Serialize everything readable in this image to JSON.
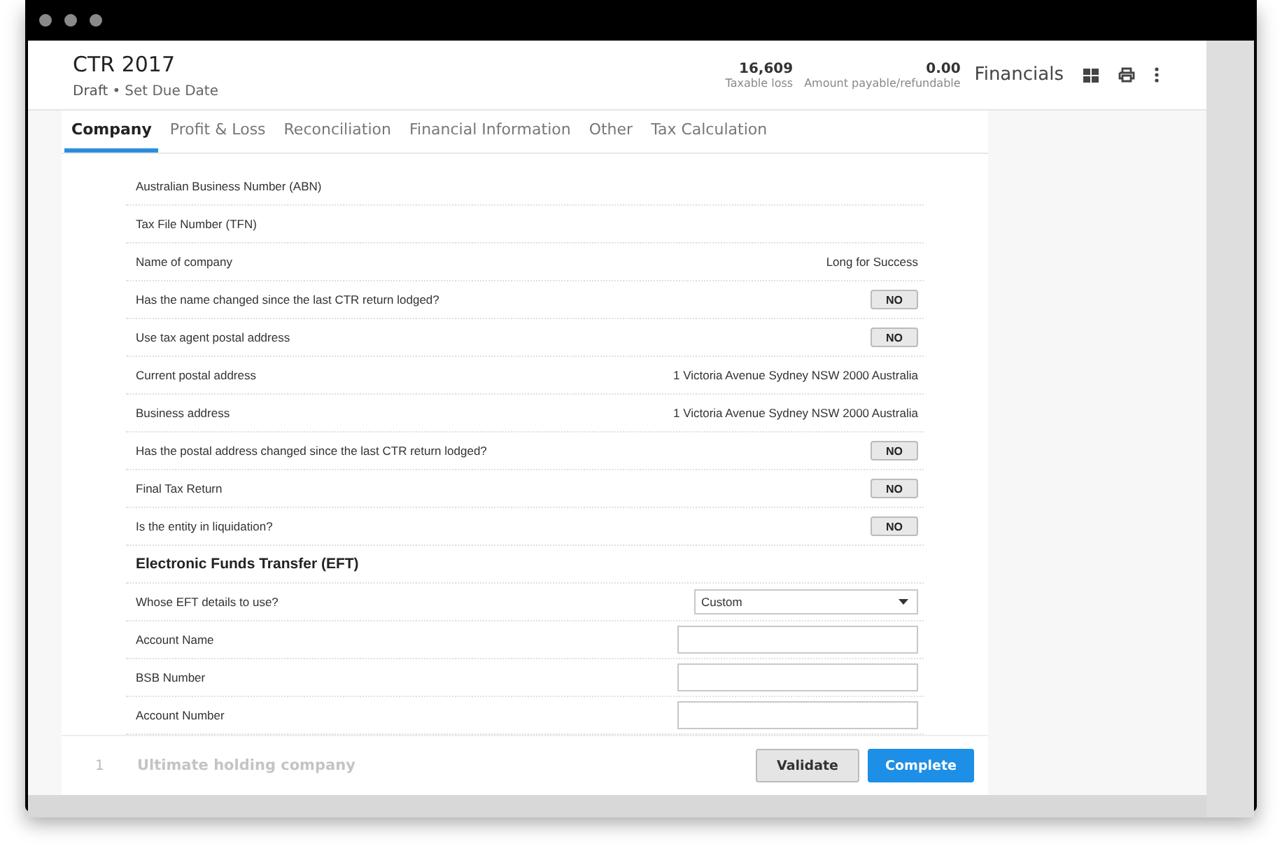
{
  "header": {
    "title": "CTR 2017",
    "status": "Draft",
    "separator": "•",
    "due_date_link": "Set Due Date",
    "stats": [
      {
        "value": "16,609",
        "label": "Taxable loss"
      },
      {
        "value": "0.00",
        "label": "Amount payable/refundable"
      }
    ],
    "financials_link": "Financials"
  },
  "tabs": [
    {
      "label": "Company",
      "selected": true
    },
    {
      "label": "Profit & Loss",
      "selected": false
    },
    {
      "label": "Reconciliation",
      "selected": false
    },
    {
      "label": "Financial Information",
      "selected": false
    },
    {
      "label": "Other",
      "selected": false
    },
    {
      "label": "Tax Calculation",
      "selected": false
    }
  ],
  "rows": [
    {
      "kind": "text",
      "label": "Australian Business Number (ABN)"
    },
    {
      "kind": "text",
      "label": "Tax File Number (TFN)"
    },
    {
      "kind": "text",
      "label": "Name of company",
      "value": "Long for Success"
    },
    {
      "kind": "toggle",
      "label": "Has the name changed since the last CTR return lodged?",
      "value": "NO"
    },
    {
      "kind": "toggle",
      "label": "Use tax agent postal address",
      "value": "NO"
    },
    {
      "kind": "text",
      "label": "Current postal address",
      "value": "1 Victoria Avenue Sydney NSW 2000 Australia"
    },
    {
      "kind": "text",
      "label": "Business address",
      "value": "1 Victoria Avenue Sydney NSW 2000 Australia"
    },
    {
      "kind": "toggle",
      "label": "Has the postal address changed since the last CTR return lodged?",
      "value": "NO"
    },
    {
      "kind": "toggle",
      "label": "Final Tax Return",
      "value": "NO"
    },
    {
      "kind": "toggle",
      "label": "Is the entity in liquidation?",
      "value": "NO"
    },
    {
      "kind": "heading",
      "label": "Electronic Funds Transfer (EFT)"
    },
    {
      "kind": "select",
      "label": "Whose EFT details to use?",
      "value": "Custom"
    },
    {
      "kind": "input",
      "label": "Account Name"
    },
    {
      "kind": "input",
      "label": "BSB Number"
    },
    {
      "kind": "input",
      "label": "Account Number"
    }
  ],
  "footer": {
    "section_number": "1",
    "section_title": "Ultimate holding company",
    "buttons": [
      {
        "label": "Validate",
        "kind": "secondary"
      },
      {
        "label": "Complete",
        "kind": "primary"
      }
    ]
  }
}
